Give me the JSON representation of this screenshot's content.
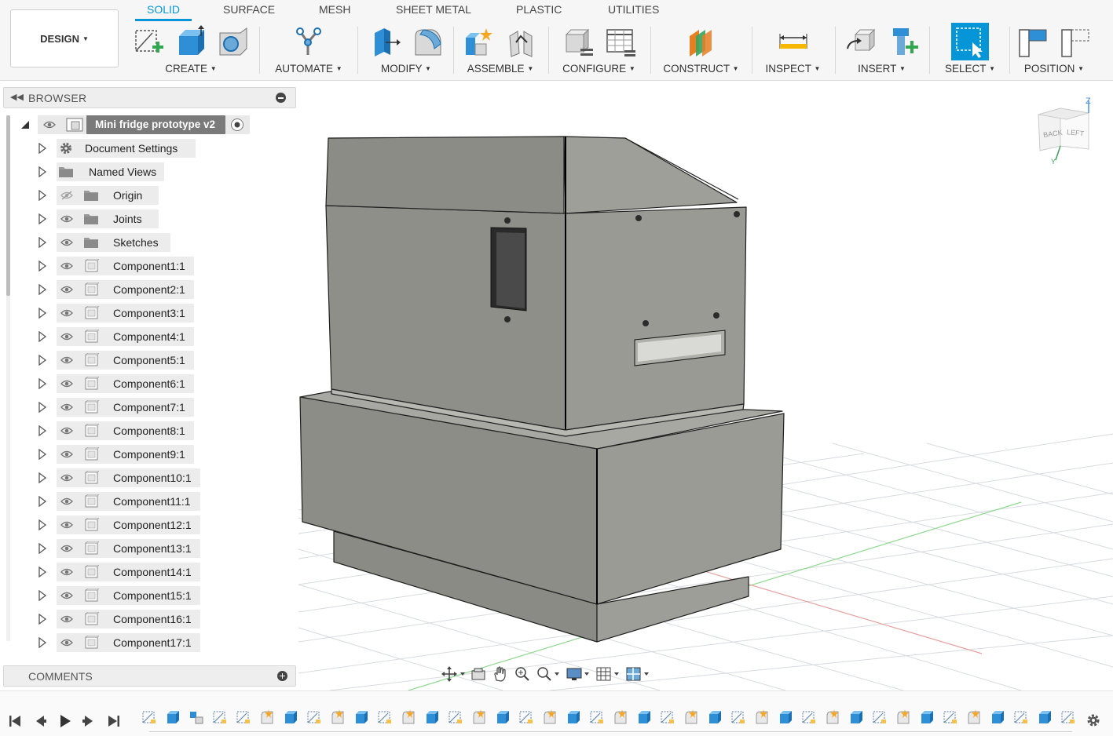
{
  "app": {
    "workspace_label": "DESIGN"
  },
  "tabs": [
    {
      "label": "SOLID",
      "active": true
    },
    {
      "label": "SURFACE",
      "active": false
    },
    {
      "label": "MESH",
      "active": false
    },
    {
      "label": "SHEET METAL",
      "active": false
    },
    {
      "label": "PLASTIC",
      "active": false
    },
    {
      "label": "UTILITIES",
      "active": false
    }
  ],
  "toolbar_groups": {
    "create": "CREATE",
    "automate": "AUTOMATE",
    "modify": "MODIFY",
    "assemble": "ASSEMBLE",
    "configure": "CONFIGURE",
    "construct": "CONSTRUCT",
    "inspect": "INSPECT",
    "insert": "INSERT",
    "select": "SELECT",
    "position": "POSITION"
  },
  "browser": {
    "title": "BROWSER",
    "root": "Mini fridge prototype v2",
    "items": [
      {
        "label": "Document Settings",
        "icon": "gear-icon",
        "eye": false
      },
      {
        "label": "Named Views",
        "icon": "folder-icon",
        "eye": false
      },
      {
        "label": "Origin",
        "icon": "folder-icon",
        "eye": "hidden"
      },
      {
        "label": "Joints",
        "icon": "folder-icon",
        "eye": true
      },
      {
        "label": "Sketches",
        "icon": "folder-icon",
        "eye": true
      },
      {
        "label": "Component1:1",
        "icon": "component-icon",
        "eye": true
      },
      {
        "label": "Component2:1",
        "icon": "component-icon",
        "eye": true
      },
      {
        "label": "Component3:1",
        "icon": "component-icon",
        "eye": true
      },
      {
        "label": "Component4:1",
        "icon": "component-icon",
        "eye": true
      },
      {
        "label": "Component5:1",
        "icon": "component-icon",
        "eye": true
      },
      {
        "label": "Component6:1",
        "icon": "component-icon",
        "eye": true
      },
      {
        "label": "Component7:1",
        "icon": "component-icon",
        "eye": true
      },
      {
        "label": "Component8:1",
        "icon": "component-icon",
        "eye": true
      },
      {
        "label": "Component9:1",
        "icon": "component-icon",
        "eye": true
      },
      {
        "label": "Component10:1",
        "icon": "component-icon",
        "eye": true
      },
      {
        "label": "Component11:1",
        "icon": "component-icon",
        "eye": true
      },
      {
        "label": "Component12:1",
        "icon": "component-icon",
        "eye": true
      },
      {
        "label": "Component13:1",
        "icon": "component-icon",
        "eye": true
      },
      {
        "label": "Component14:1",
        "icon": "component-icon",
        "eye": true
      },
      {
        "label": "Component15:1",
        "icon": "component-icon",
        "eye": true
      },
      {
        "label": "Component16:1",
        "icon": "component-icon",
        "eye": true
      },
      {
        "label": "Component17:1",
        "icon": "component-icon",
        "eye": true
      }
    ]
  },
  "comments": {
    "title": "COMMENTS"
  },
  "viewcube": {
    "face_back": "BACK",
    "face_left": "LEFT",
    "axis_z": "Z",
    "axis_y": "Y"
  },
  "timeline": {
    "feature_count": 40
  },
  "colors": {
    "accent": "#0696d7",
    "model_face": "#8b8b86",
    "model_face_light": "#9b9b96",
    "grid": "#d7dbe0"
  }
}
